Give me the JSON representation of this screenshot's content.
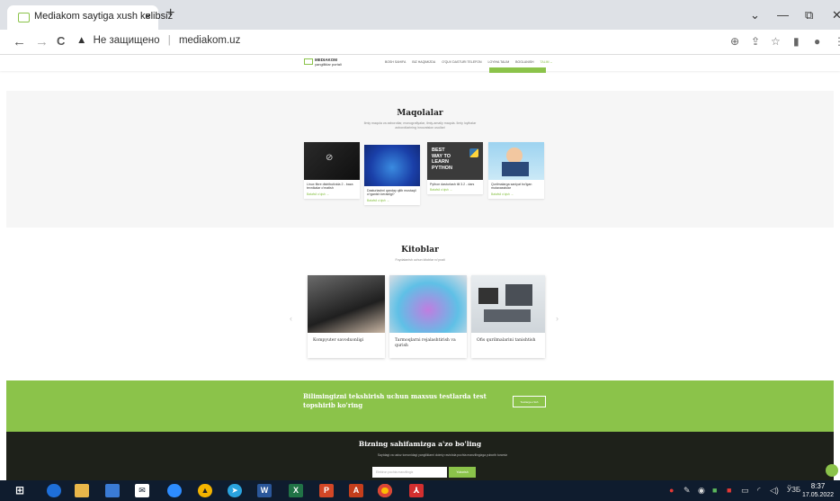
{
  "browser": {
    "tab_title": "Mediakom saytiga xush kelibsiz",
    "tab_close": "×",
    "new_tab": "+",
    "back": "←",
    "forward": "→",
    "reload": "C",
    "security_label": "Не защищено",
    "url": "mediakom.uz",
    "minimize": "—",
    "restore": "⧉",
    "close": "✕",
    "tab_menu": "⌄"
  },
  "site": {
    "logo_title": "MEDIAKOM",
    "logo_sub": "yangiliklar portali",
    "menu": [
      {
        "label": "BOSH SAHIFA",
        "active": false
      },
      {
        "label": "BIZ HAQIMIZDA",
        "active": false
      },
      {
        "label": "O'QUV DASTURI TELEFON",
        "active": false
      },
      {
        "label": "LOYIHA TALIM",
        "active": false
      },
      {
        "label": "BOGLANISH",
        "active": false
      },
      {
        "label": "TALIM ⌄",
        "active": true
      }
    ],
    "articles": {
      "title": "Maqolalar",
      "subtitle_1": "Ilmiy maqola va axborotlar, monografiyalar, ilmiy-amaliy maqola. Ilmiy loyihalar",
      "subtitle_2": "axborotlarining innovatsion usullari",
      "more_label": "Batafsil o'qish →",
      "items": [
        {
          "title": "Linux fibre distributivida 2 - baza texnikalar o'rnatish"
        },
        {
          "title": "Dasturlashni qanday qilib mustaqil o'rganish kerakligi?"
        },
        {
          "title": "Python dasturlash tili 3.2 - dars"
        },
        {
          "title": "Qurilmalarga saniyat bo'lgan mutaxassislar"
        }
      ]
    },
    "books": {
      "title": "Kitoblar",
      "subtitle": "Foydalanish uchun kitoblar ro'yxati",
      "prev": "‹",
      "next": "›",
      "items": [
        {
          "title": "Kompyuter savodxonligi"
        },
        {
          "title": "Tarmoqlarni rejalashtirish va qurish"
        },
        {
          "title": "Ofis qurilmalarini tanishtish"
        }
      ]
    },
    "cta": {
      "text": "Bilimingizni tekshirish uchun maxsus testlarda test topshirib ko'ring",
      "button": "Testlarga o'tish"
    },
    "subscribe": {
      "title": "Bizning sahifamizga a'zo bo'ling",
      "subtitle": "Saytdagi va ustoz tomonidagi yangiliklarni doimiy ravishda pochta manzilingizga yuborib turamiz",
      "placeholder": "Elektron pochta manzilingiz",
      "button": "Yuborish"
    }
  },
  "taskbar": {
    "lang": "ЎЗБ",
    "time": "8:37",
    "date": "17.05.2022"
  }
}
